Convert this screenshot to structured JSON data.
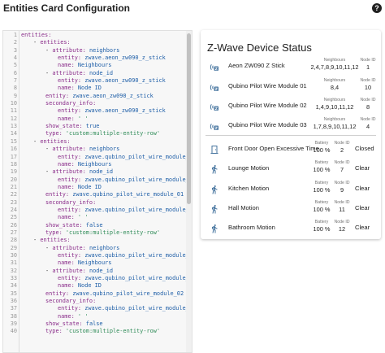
{
  "header": {
    "title": "Entities Card Configuration",
    "help_icon": "help-circle-icon"
  },
  "editor": {
    "lines": [
      {
        "n": "1",
        "i": 0,
        "t": [
          [
            "k",
            "entities:"
          ]
        ]
      },
      {
        "n": "2",
        "i": 1,
        "t": [
          [
            "d",
            "- "
          ],
          [
            "k",
            "entities:"
          ]
        ]
      },
      {
        "n": "3",
        "i": 2,
        "t": [
          [
            "d",
            "- "
          ],
          [
            "k",
            "attribute: "
          ],
          [
            "v",
            "neighbors"
          ]
        ]
      },
      {
        "n": "4",
        "i": 3,
        "t": [
          [
            "k",
            "entity: "
          ],
          [
            "v",
            "zwave.aeon_zw090_z_stick"
          ]
        ]
      },
      {
        "n": "5",
        "i": 3,
        "t": [
          [
            "k",
            "name: "
          ],
          [
            "v",
            "Neighbours"
          ]
        ]
      },
      {
        "n": "6",
        "i": 2,
        "t": [
          [
            "d",
            "- "
          ],
          [
            "k",
            "attribute: "
          ],
          [
            "v",
            "node_id"
          ]
        ]
      },
      {
        "n": "7",
        "i": 3,
        "t": [
          [
            "k",
            "entity: "
          ],
          [
            "v",
            "zwave.aeon_zw090_z_stick"
          ]
        ]
      },
      {
        "n": "8",
        "i": 3,
        "t": [
          [
            "k",
            "name: "
          ],
          [
            "v",
            "Node ID"
          ]
        ]
      },
      {
        "n": "9",
        "i": 2,
        "t": [
          [
            "k",
            "entity: "
          ],
          [
            "v",
            "zwave.aeon_zw090_z_stick"
          ]
        ]
      },
      {
        "n": "10",
        "i": 2,
        "t": [
          [
            "k",
            "secondary_info:"
          ]
        ]
      },
      {
        "n": "11",
        "i": 3,
        "t": [
          [
            "k",
            "entity: "
          ],
          [
            "v",
            "zwave.aeon_zw090_z_stick"
          ]
        ]
      },
      {
        "n": "12",
        "i": 3,
        "t": [
          [
            "k",
            "name: "
          ],
          [
            "s",
            "' '"
          ]
        ]
      },
      {
        "n": "13",
        "i": 2,
        "t": [
          [
            "k",
            "show_state: "
          ],
          [
            "v",
            "true"
          ]
        ]
      },
      {
        "n": "14",
        "i": 2,
        "t": [
          [
            "k",
            "type: "
          ],
          [
            "s",
            "'custom:multiple-entity-row'"
          ]
        ]
      },
      {
        "n": "15",
        "i": 1,
        "t": [
          [
            "d",
            "- "
          ],
          [
            "k",
            "entities:"
          ]
        ]
      },
      {
        "n": "16",
        "i": 2,
        "t": [
          [
            "d",
            "- "
          ],
          [
            "k",
            "attribute: "
          ],
          [
            "v",
            "neighbors"
          ]
        ]
      },
      {
        "n": "17",
        "i": 3,
        "t": [
          [
            "k",
            "entity: "
          ],
          [
            "v",
            "zwave.qubino_pilot_wire_module_01"
          ]
        ]
      },
      {
        "n": "18",
        "i": 3,
        "t": [
          [
            "k",
            "name: "
          ],
          [
            "v",
            "Neighbours"
          ]
        ]
      },
      {
        "n": "19",
        "i": 2,
        "t": [
          [
            "d",
            "- "
          ],
          [
            "k",
            "attribute: "
          ],
          [
            "v",
            "node_id"
          ]
        ]
      },
      {
        "n": "20",
        "i": 3,
        "t": [
          [
            "k",
            "entity: "
          ],
          [
            "v",
            "zwave.qubino_pilot_wire_module_01"
          ]
        ]
      },
      {
        "n": "21",
        "i": 3,
        "t": [
          [
            "k",
            "name: "
          ],
          [
            "v",
            "Node ID"
          ]
        ]
      },
      {
        "n": "22",
        "i": 2,
        "t": [
          [
            "k",
            "entity: "
          ],
          [
            "v",
            "zwave.qubino_pilot_wire_module_01"
          ]
        ]
      },
      {
        "n": "23",
        "i": 2,
        "t": [
          [
            "k",
            "secondary_info:"
          ]
        ]
      },
      {
        "n": "24",
        "i": 3,
        "t": [
          [
            "k",
            "entity: "
          ],
          [
            "v",
            "zwave.qubino_pilot_wire_module_01"
          ]
        ]
      },
      {
        "n": "25",
        "i": 3,
        "t": [
          [
            "k",
            "name: "
          ],
          [
            "s",
            "' '"
          ]
        ]
      },
      {
        "n": "26",
        "i": 2,
        "t": [
          [
            "k",
            "show_state: "
          ],
          [
            "v",
            "false"
          ]
        ]
      },
      {
        "n": "27",
        "i": 2,
        "t": [
          [
            "k",
            "type: "
          ],
          [
            "s",
            "'custom:multiple-entity-row'"
          ]
        ]
      },
      {
        "n": "28",
        "i": 1,
        "t": [
          [
            "d",
            "- "
          ],
          [
            "k",
            "entities:"
          ]
        ]
      },
      {
        "n": "29",
        "i": 2,
        "t": [
          [
            "d",
            "- "
          ],
          [
            "k",
            "attribute: "
          ],
          [
            "v",
            "neighbors"
          ]
        ]
      },
      {
        "n": "30",
        "i": 3,
        "t": [
          [
            "k",
            "entity: "
          ],
          [
            "v",
            "zwave.qubino_pilot_wire_module_02"
          ]
        ]
      },
      {
        "n": "31",
        "i": 3,
        "t": [
          [
            "k",
            "name: "
          ],
          [
            "v",
            "Neighbours"
          ]
        ]
      },
      {
        "n": "32",
        "i": 2,
        "t": [
          [
            "d",
            "- "
          ],
          [
            "k",
            "attribute: "
          ],
          [
            "v",
            "node_id"
          ]
        ]
      },
      {
        "n": "33",
        "i": 3,
        "t": [
          [
            "k",
            "entity: "
          ],
          [
            "v",
            "zwave.qubino_pilot_wire_module_02"
          ]
        ]
      },
      {
        "n": "34",
        "i": 3,
        "t": [
          [
            "k",
            "name: "
          ],
          [
            "v",
            "Node ID"
          ]
        ]
      },
      {
        "n": "35",
        "i": 2,
        "t": [
          [
            "k",
            "entity: "
          ],
          [
            "v",
            "zwave.qubino_pilot_wire_module_02"
          ]
        ]
      },
      {
        "n": "36",
        "i": 2,
        "t": [
          [
            "k",
            "secondary_info:"
          ]
        ]
      },
      {
        "n": "37",
        "i": 3,
        "t": [
          [
            "k",
            "entity: "
          ],
          [
            "v",
            "zwave.qubino_pilot_wire_module_02"
          ]
        ]
      },
      {
        "n": "38",
        "i": 3,
        "t": [
          [
            "k",
            "name: "
          ],
          [
            "s",
            "' '"
          ]
        ]
      },
      {
        "n": "39",
        "i": 2,
        "t": [
          [
            "k",
            "show_state: "
          ],
          [
            "v",
            "false"
          ]
        ]
      },
      {
        "n": "40",
        "i": 2,
        "t": [
          [
            "k",
            "type: "
          ],
          [
            "s",
            "'custom:multiple-entity-row'"
          ]
        ]
      }
    ]
  },
  "preview": {
    "title": "Z-Wave Device Status",
    "devices": [
      {
        "name": "Aeon ZW090 Z Stick",
        "icon": "zwave-icon",
        "neighbours_label": "Neighbours",
        "neighbours": "2,4,7,8,9,10,11,12",
        "node_label": "Node ID",
        "node_id": "1"
      },
      {
        "name": "Qubino Pilot Wire Module 01",
        "icon": "zwave-icon",
        "neighbours_label": "Neighbours",
        "neighbours": "8,4",
        "node_label": "Node ID",
        "node_id": "10"
      },
      {
        "name": "Qubino Pilot Wire Module 02",
        "icon": "zwave-icon",
        "neighbours_label": "Neighbours",
        "neighbours": "1,4,9,10,11,12",
        "node_label": "Node ID",
        "node_id": "8"
      },
      {
        "name": "Qubino Pilot Wire Module 03",
        "icon": "zwave-icon",
        "neighbours_label": "Neighbours",
        "neighbours": "1,7,8,9,10,11,12",
        "node_label": "Node ID",
        "node_id": "4"
      }
    ],
    "sensors": [
      {
        "name": "Front Door Open Excessive Time",
        "icon": "door-icon",
        "battery_label": "Battery",
        "battery": "100 %",
        "node_label": "Node ID",
        "node_id": "2",
        "state": "Closed"
      },
      {
        "name": "Lounge Motion",
        "icon": "walk-icon",
        "battery_label": "Battery",
        "battery": "100 %",
        "node_label": "Node ID",
        "node_id": "7",
        "state": "Clear"
      },
      {
        "name": "Kitchen Motion",
        "icon": "walk-icon",
        "battery_label": "Battery",
        "battery": "100 %",
        "node_label": "Node ID",
        "node_id": "9",
        "state": "Clear"
      },
      {
        "name": "Hall Motion",
        "icon": "walk-icon",
        "battery_label": "Battery",
        "battery": "100 %",
        "node_label": "Node ID",
        "node_id": "11",
        "state": "Clear"
      },
      {
        "name": "Bathroom Motion",
        "icon": "walk-icon",
        "battery_label": "Battery",
        "battery": "100 %",
        "node_label": "Node ID",
        "node_id": "12",
        "state": "Clear"
      }
    ]
  },
  "colors": {
    "icon": "#44739e",
    "keyword": "#8a2d8a",
    "string": "#2e8b57",
    "value": "#1f5fa8"
  }
}
